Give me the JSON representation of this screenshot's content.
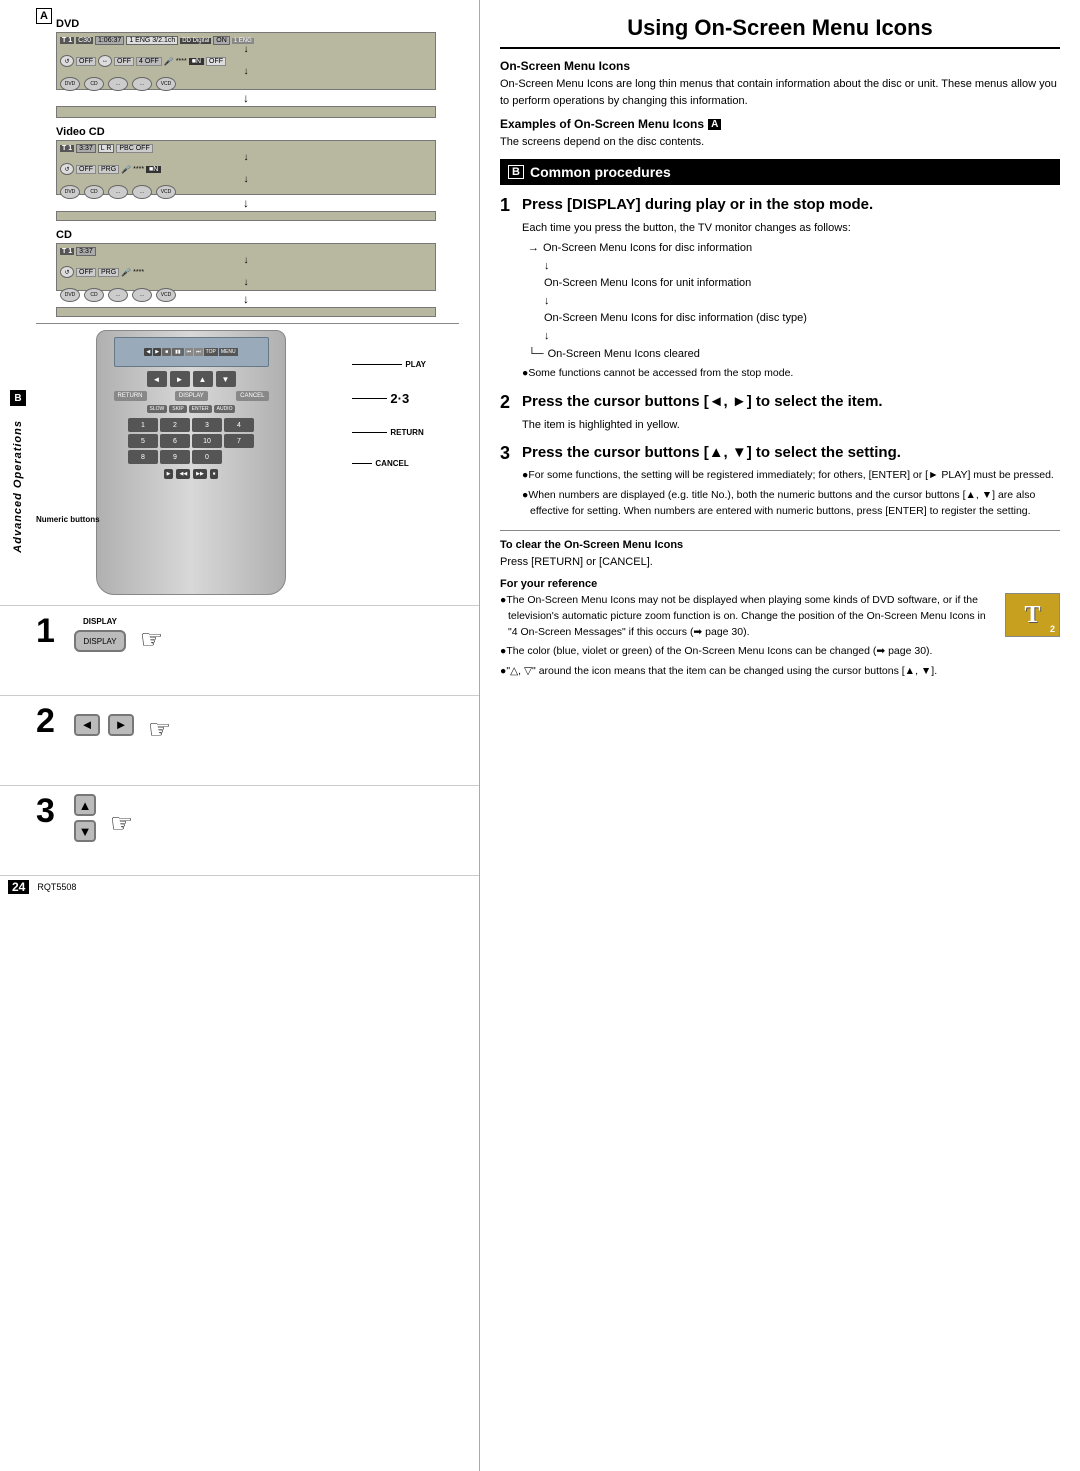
{
  "page": {
    "title": "Using On-Screen Menu Icons",
    "page_number": "24",
    "model_code": "RQT5508"
  },
  "side_label": "Advanced Operations",
  "section_a": {
    "label": "A",
    "disc_types": [
      {
        "name": "DVD",
        "rows": [
          "T1  C30  1:06:37  1 ENG 3/2.1ch  1 ENG",
          "OFF  OFF  OFF  ****  N  OFF",
          "DVD  CD  ...  ...  VCD"
        ]
      },
      {
        "name": "Video CD",
        "rows": [
          "T1  3:37  L R  PBC OFF",
          "OFF  PRG  ****  N",
          "DVD  CD  ...  ...  VCD"
        ]
      },
      {
        "name": "CD",
        "rows": [
          "T1  3:37",
          "OFF  PRG  ****",
          "DVD  CD  ...  ...  VCD"
        ]
      }
    ]
  },
  "section_b": {
    "label": "B",
    "remote_labels": {
      "play": "PLAY",
      "label_23": "2·3",
      "return": "RETURN",
      "cancel": "CANCEL",
      "numeric": "Numeric buttons"
    }
  },
  "steps_left": [
    {
      "number": "1",
      "label": "DISPLAY",
      "description": "DISPLAY button"
    },
    {
      "number": "2",
      "label": "cursor left right buttons",
      "description": "cursor left/right buttons"
    },
    {
      "number": "3",
      "label": "cursor up down button",
      "description": "cursor up/down button"
    }
  ],
  "right_panel": {
    "title": "Using On-Screen Menu Icons",
    "on_screen_section": {
      "header": "On-Screen Menu Icons",
      "text": "On-Screen Menu Icons are long thin menus that contain information about the disc or unit. These menus allow you to perform operations by changing this information."
    },
    "examples_section": {
      "header": "Examples of On-Screen Menu Icons",
      "label": "A",
      "subtext": "The screens depend on the disc contents."
    },
    "common_procedures": {
      "label": "B",
      "header": "Common procedures"
    },
    "step1": {
      "number": "1",
      "heading": "Press [DISPLAY] during play or in the stop mode.",
      "body": "Each time you press the button, the TV monitor changes as follows:",
      "flow": [
        "On-Screen Menu Icons for disc information",
        "On-Screen Menu Icons for unit information",
        "On-Screen Menu Icons for disc information (disc type)",
        "On-Screen Menu Icons cleared"
      ],
      "note": "●Some functions cannot be accessed from the stop mode."
    },
    "step2": {
      "number": "2",
      "heading": "Press the cursor buttons [◄, ►] to select the item.",
      "body": "The item is highlighted in yellow."
    },
    "step3": {
      "number": "3",
      "heading": "Press the cursor buttons [▲, ▼] to select the setting.",
      "bullets": [
        "●For some functions, the setting will be registered immediately; for others, [ENTER] or [► PLAY] must be pressed.",
        "●When numbers are displayed (e.g. title No.), both the numeric buttons and the cursor buttons [▲, ▼] are also effective for setting. When numbers are entered with numeric buttons, press [ENTER] to register the setting."
      ]
    },
    "clear_section": {
      "header": "To clear the On-Screen Menu Icons",
      "text": "Press [RETURN] or [CANCEL]."
    },
    "reference_section": {
      "header": "For your reference",
      "bullets": [
        "●The On-Screen Menu Icons may not be displayed when playing some kinds of DVD software, or if the television's automatic picture zoom function is on. Change the position of the On-Screen Menu Icons in \"4 On-Screen Messages\" if this occurs (➡ page 30).",
        "●The color (blue, violet or green) of the On-Screen Menu Icons can be changed (➡ page 30).",
        "●\"△, ▽\" around the icon means that the item can be changed using the cursor buttons [▲, ▼]."
      ]
    },
    "icon_thumb": {
      "label": "T",
      "number": "2"
    }
  }
}
